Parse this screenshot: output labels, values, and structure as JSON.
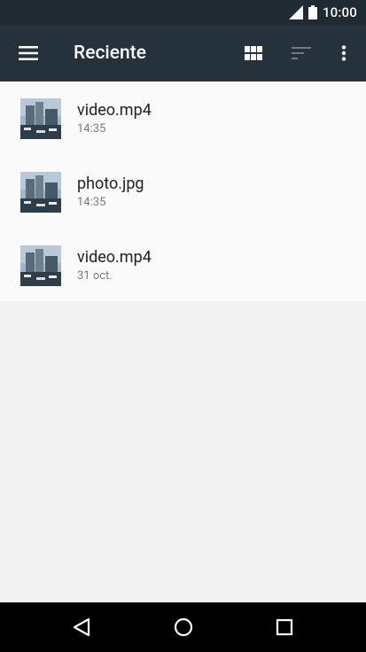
{
  "status_bar": {
    "time": "10:00",
    "icons": [
      "signal-icon",
      "battery-icon"
    ]
  },
  "app_bar": {
    "title": "Reciente",
    "menu_icon": "hamburger-menu-icon",
    "view_icon": "grid-view-icon",
    "sort_icon": "sort-icon",
    "overflow_icon": "more-vert-icon"
  },
  "files": [
    {
      "name": "video.mp4",
      "date": "14:35",
      "type": "video"
    },
    {
      "name": "photo.jpg",
      "date": "14:35",
      "type": "image"
    },
    {
      "name": "video.mp4",
      "date": "31 oct.",
      "type": "video"
    }
  ],
  "nav_bar": {
    "icons": [
      "back-icon",
      "home-icon",
      "recents-icon"
    ]
  },
  "colors": {
    "app_bar": "#26323b",
    "status_bar": "#1f2a33",
    "list_bg": "#fafafa",
    "page_bg": "#f2f2f2",
    "nav_bar": "#000000"
  }
}
